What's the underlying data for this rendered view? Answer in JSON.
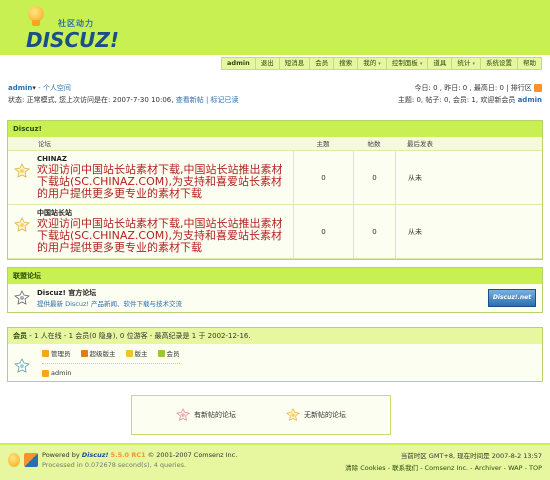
{
  "logo": {
    "main": "DISCUZ!",
    "sub": "社区动力"
  },
  "menu": [
    {
      "label": "admin",
      "arrow": false
    },
    {
      "label": "退出",
      "arrow": false
    },
    {
      "label": "短消息",
      "arrow": false
    },
    {
      "label": "会员",
      "arrow": false
    },
    {
      "label": "搜索",
      "arrow": false
    },
    {
      "label": "我的",
      "arrow": true
    },
    {
      "label": "控制面板",
      "arrow": true
    },
    {
      "label": "道具",
      "arrow": false
    },
    {
      "label": "统计",
      "arrow": true
    },
    {
      "label": "系统设置",
      "arrow": false
    },
    {
      "label": "帮助",
      "arrow": false
    }
  ],
  "user": {
    "name": "admin",
    "arrow": "▾",
    "space_label": "- 个人空间",
    "status_prefix": "状态: 正常模式, 您上次访问是在: 2007-7-30 10:06,",
    "view_new": "查看新帖",
    "mark_read": "| 标记已读"
  },
  "stats": {
    "line1": "今日: 0 , 昨日: 0 , 最高日: 0 | 排行区",
    "line2": "主题: 0, 帖子: 0, 会员: 1, 欢迎新会员",
    "new_member": "admin"
  },
  "forum_box": {
    "title": "Discuz!",
    "headers": {
      "forum": "论坛",
      "topics": "主题",
      "posts": "帖数",
      "last": "最后发表"
    },
    "rows": [
      {
        "name": "CHINAZ",
        "desc": "欢迎访问中国站长站素材下载,中国站长站推出素材下载站(SC.CHINAZ.COM),为支持和喜爱站长素材的用户提供更多更专业的素材下载",
        "topics": "0",
        "posts": "0",
        "last": "从未"
      },
      {
        "name": "中国站长站",
        "desc": "欢迎访问中国站长站素材下载,中国站长站推出素材下载站(SC.CHINAZ.COM),为支持和喜爱站长素材的用户提供更多更专业的素材下载",
        "topics": "0",
        "posts": "0",
        "last": "从未"
      }
    ]
  },
  "partner_box": {
    "title": "联盟论坛",
    "name": "Discuz! 官方论坛",
    "desc": "提供最新 Discuz! 产品新闻、软件下载与技术交流",
    "logo_text": "Discuz!.net"
  },
  "online": {
    "title": "会员",
    "summary": " - 1 人在线 - 1 会员(0 隐身), 0 位游客 - 最高纪录是 1 于 2002-12-16.",
    "legend": [
      {
        "label": "管理员",
        "color": "#f7a51c"
      },
      {
        "label": "超级版主",
        "color": "#e07b1a"
      },
      {
        "label": "版主",
        "color": "#f2c230"
      },
      {
        "label": "会员",
        "color": "#9bc53d"
      }
    ],
    "users": [
      "admin"
    ]
  },
  "new_legend": {
    "new": "有新帖的论坛",
    "none": "无新帖的论坛"
  },
  "footer": {
    "powered": "Powered by",
    "brand": "Discuz!",
    "version": "5.5.0 RC1",
    "copyright": "© 2001-2007 Comsenz Inc.",
    "processed": "Processed in 0.072678 second(s), 4 queries.",
    "time": "当前时区 GMT+8, 现在时间是 2007-8-2 13:57",
    "links": "清除 Cookies - 联系我们 - Comsenz Inc. - Archiver - WAP - TOP"
  },
  "colors": {
    "accent": "#c9f053",
    "link": "#2a6fb0",
    "desc_red": "#b22222"
  }
}
